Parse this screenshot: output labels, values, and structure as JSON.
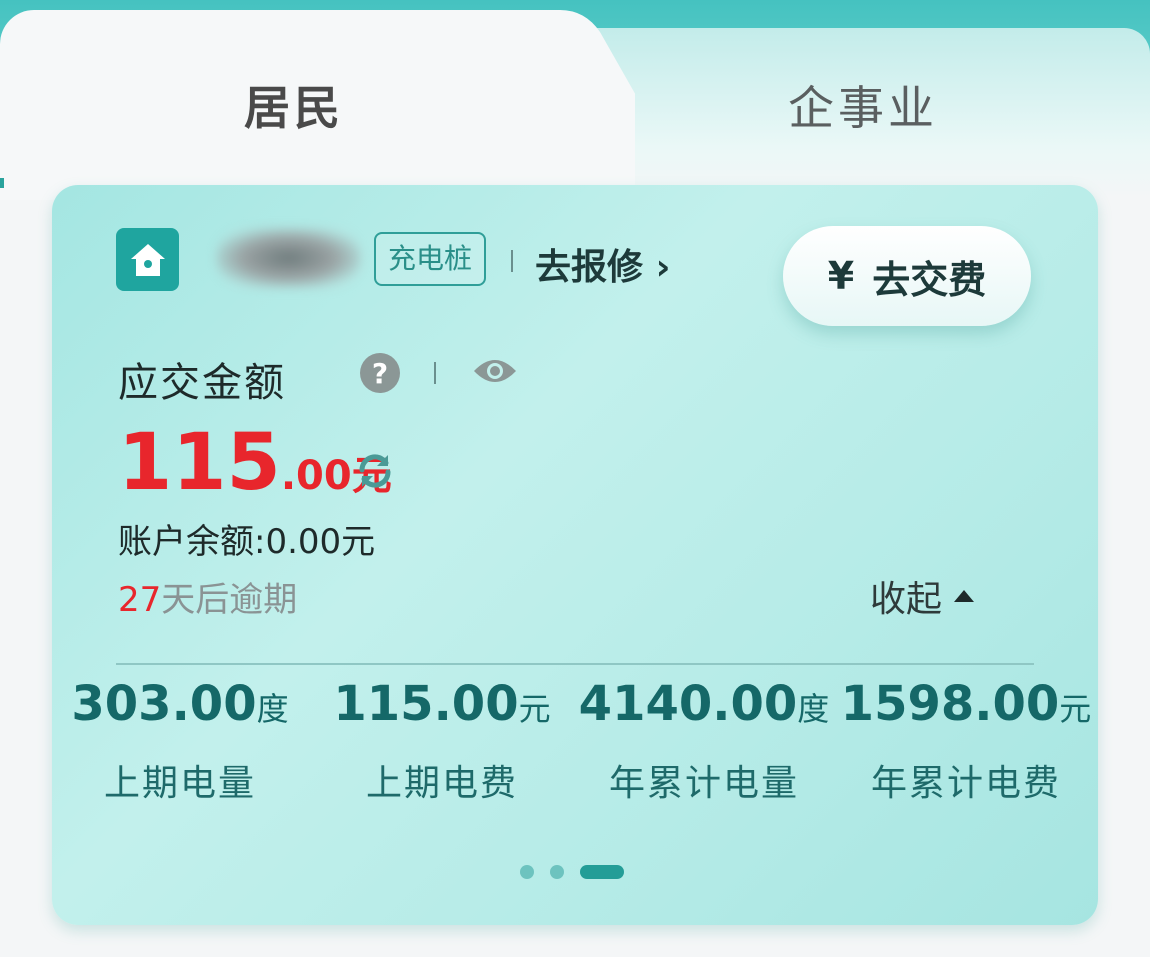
{
  "tabs": {
    "resident": "居民",
    "enterprise": "企事业"
  },
  "account": {
    "tag": "充电桩",
    "repair": "去报修",
    "repair_chevron": "›",
    "pay_button": "去交费",
    "pay_icon": "¥"
  },
  "due_section": {
    "label": "应交金额",
    "help_icon": "?",
    "amount_int": "115",
    "amount_frac": ".00元",
    "balance": "账户余额:0.00元",
    "overdue_days": "27",
    "overdue_text": "天后逾期",
    "collapse": "收起"
  },
  "stats": [
    {
      "value": "303.00",
      "unit": "度",
      "label": "上期电量"
    },
    {
      "value": "115.00",
      "unit": "元",
      "label": "上期电费"
    },
    {
      "value": "4140.00",
      "unit": "度",
      "label": "年累计电量"
    },
    {
      "value": "1598.00",
      "unit": "元",
      "label": "年累计电费"
    }
  ],
  "pager": {
    "count": 3,
    "active_index": 2
  },
  "colors": {
    "accent": "#1fa59f",
    "amount_red": "#e8262c",
    "stat_text": "#156868"
  }
}
